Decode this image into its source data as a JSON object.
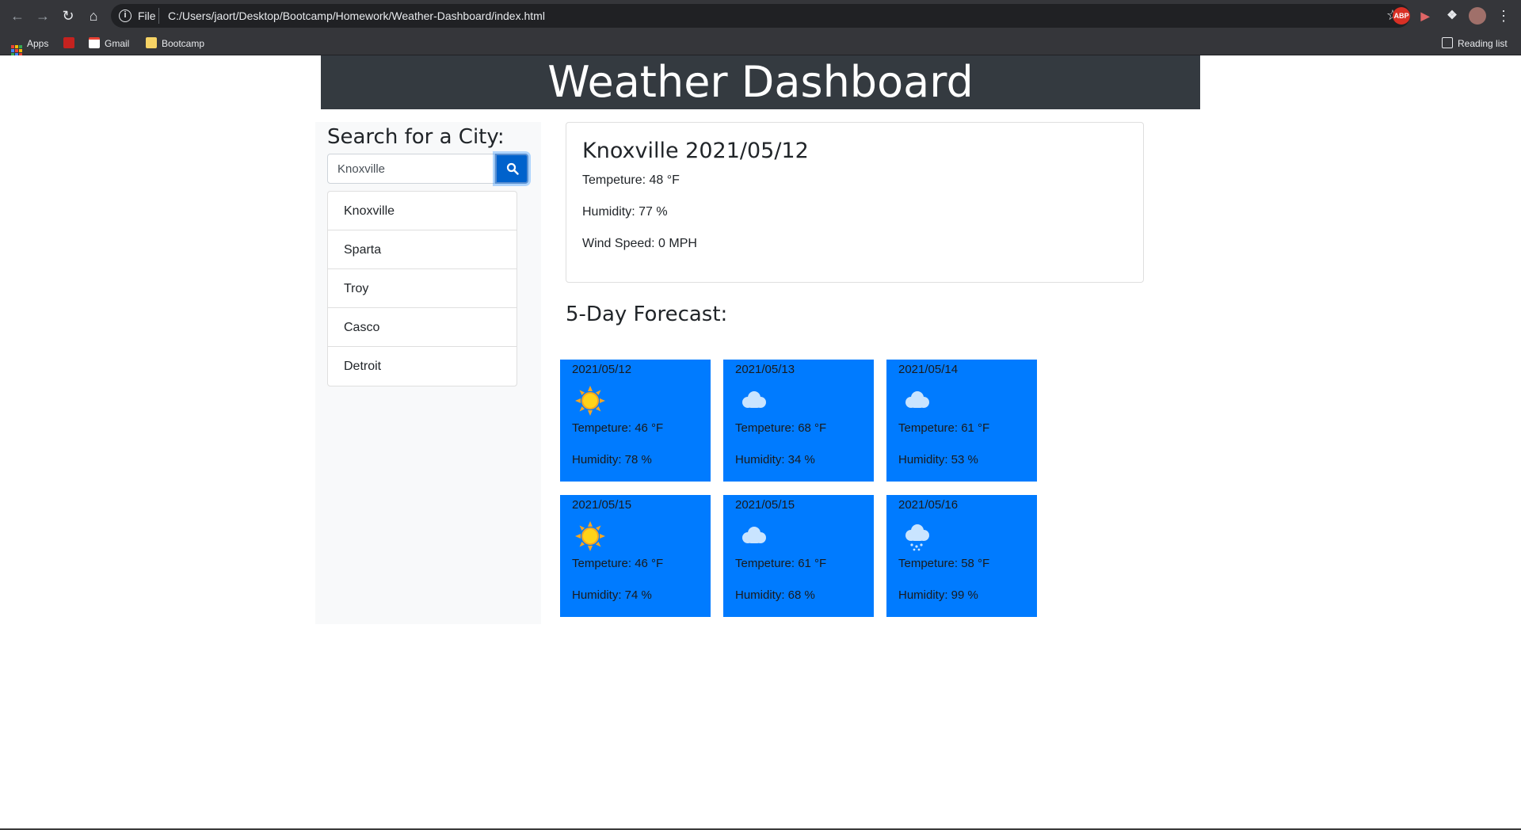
{
  "browser": {
    "scheme": "File",
    "url": "C:/Users/jaort/Desktop/Bootcamp/Homework/Weather-Dashboard/index.html",
    "bookmarks": [
      {
        "label": "Apps",
        "icon": "apps-grid-icon"
      },
      {
        "label": "",
        "icon": "red-bookmark-icon"
      },
      {
        "label": "Gmail",
        "icon": "gmail-icon"
      },
      {
        "label": "Bootcamp",
        "icon": "folder-icon"
      }
    ],
    "reading_list": "Reading list",
    "extensions": [
      "ABP"
    ]
  },
  "header": {
    "title": "Weather Dashboard"
  },
  "search": {
    "heading": "Search for a City:",
    "value": "Knoxville",
    "button_icon": "search-icon"
  },
  "history": [
    "Knoxville",
    "Sparta",
    "Troy",
    "Casco",
    "Detroit"
  ],
  "current": {
    "title": "Knoxville 2021/05/12",
    "temperature": "Tempeture: 48 °F",
    "humidity": "Humidity: 77 %",
    "wind": "Wind Speed: 0 MPH"
  },
  "forecast": {
    "heading": "5-Day Forecast:",
    "days": [
      {
        "date": "2021/05/12",
        "icon": "sun-icon",
        "temp": "Tempeture: 46 °F",
        "humidity": "Humidity: 78 %"
      },
      {
        "date": "2021/05/13",
        "icon": "cloud-icon",
        "temp": "Tempeture: 68 °F",
        "humidity": "Humidity: 34 %"
      },
      {
        "date": "2021/05/14",
        "icon": "cloud-icon",
        "temp": "Tempeture: 61 °F",
        "humidity": "Humidity: 53 %"
      },
      {
        "date": "2021/05/15",
        "icon": "sun-icon",
        "temp": "Tempeture: 46 °F",
        "humidity": "Humidity: 74 %"
      },
      {
        "date": "2021/05/15",
        "icon": "cloud-icon",
        "temp": "Tempeture: 61 °F",
        "humidity": "Humidity: 68 %"
      },
      {
        "date": "2021/05/16",
        "icon": "rain-cloud-icon",
        "temp": "Tempeture: 58 °F",
        "humidity": "Humidity: 99 %"
      }
    ]
  },
  "colors": {
    "header_bg": "#343a40",
    "card_bg": "#007bff",
    "button_bg": "#0062cc",
    "sidebar_bg": "#f8f9fa"
  }
}
